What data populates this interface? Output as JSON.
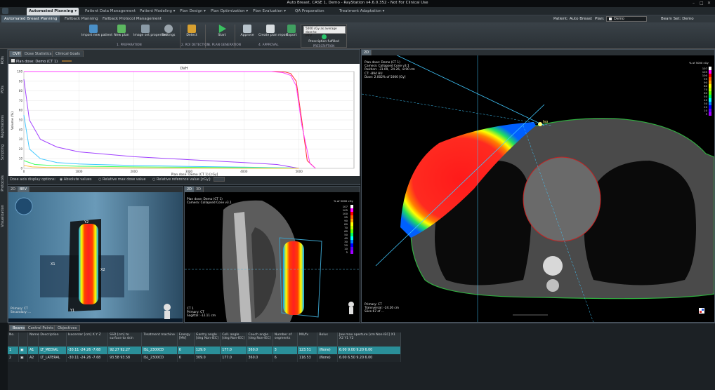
{
  "window": {
    "title": "Auto Breast, CASE 1, Demo - RayStation v4.6.0.352 - Not For Clinical Use",
    "controls": [
      "–",
      "□",
      "✕"
    ]
  },
  "nav": {
    "tabs": [
      "Automated Planning ▾",
      "Patient Data Management",
      "Patient Modeling ▾",
      "Plan Design ▾",
      "Plan Optimization ▾",
      "Plan Evaluation ▾",
      "QA Preparation",
      "Treatment Adaptation ▾"
    ]
  },
  "subnav": {
    "tabs": [
      "Automated Breast Planning",
      "Fallback Planning",
      "Fallback Protocol Management"
    ],
    "patient_label": "Patient: Auto Breast",
    "plan_label": "Plan:",
    "plan_value": "Demo",
    "beamset_label": "Beam Set: Demo"
  },
  "ribbon": {
    "buttons": [
      "Import new patient",
      "New plan",
      "Image set properties",
      "Settings",
      "Detect",
      "Start",
      "Approve",
      "Create plan report",
      "Export"
    ],
    "groups": [
      "1. PREPARATION",
      "2. ROI DETECTION",
      "3. PLAN GENERATION",
      "4. APPROVAL",
      "PRESCRIPTION"
    ],
    "prescription_box": "5000 cGy as average dose to",
    "prescription_roi": "PTV",
    "prescription_status": "Prescription fulfilled"
  },
  "left_tabs": [
    "ROIs",
    "POIs",
    "Registrations",
    "Scripting",
    "Protocols",
    "Visualization"
  ],
  "dvh_panel": {
    "tabs": [
      "DVH",
      "Dose Statistics",
      "Clinical Goals"
    ],
    "plan_dose_label": "Plan dose: Demo (CT 1)",
    "title": "DVH",
    "ylabel": "Volume (%)",
    "xlabel": "Plan dose: Demo (CT 1) [cGy]",
    "dose_options_label": "Dose axis display options:",
    "opt_absolute": "Absolute values",
    "opt_relative_max": "Relative max dose value",
    "opt_relative_ref": "Relative reference value [cGy]:"
  },
  "chart_data": {
    "type": "line",
    "title": "DVH",
    "xlabel": "Plan dose: Demo (CT 1) [cGy]",
    "ylabel": "Volume (%)",
    "xlim": [
      0,
      6000
    ],
    "ylim": [
      0,
      100
    ],
    "xticks": [
      0,
      1000,
      2000,
      3000,
      4000,
      5000
    ],
    "yticks": [
      0,
      10,
      20,
      30,
      40,
      50,
      60,
      70,
      80,
      90,
      100
    ],
    "grid": true,
    "series": [
      {
        "color": "#ff3030",
        "x": [
          0,
          4600,
          4750,
          4850,
          4950,
          5050,
          5150,
          5300
        ],
        "y": [
          100,
          100,
          99.5,
          98,
          90,
          50,
          8,
          0
        ]
      },
      {
        "color": "#ff40ff",
        "x": [
          0,
          4500,
          4700,
          4850,
          4950,
          5050,
          5200,
          5300
        ],
        "y": [
          100,
          100,
          99,
          96,
          85,
          45,
          5,
          0
        ]
      },
      {
        "color": "#a040ff",
        "x": [
          0,
          100,
          300,
          600,
          1000,
          2000,
          3000,
          4000,
          4600,
          4800,
          5000
        ],
        "y": [
          92,
          50,
          30,
          22,
          17,
          12,
          9,
          6,
          4,
          2,
          0
        ]
      },
      {
        "color": "#40c8ff",
        "x": [
          0,
          100,
          300,
          600,
          1000,
          2000,
          3000,
          4000,
          4800,
          5000
        ],
        "y": [
          55,
          20,
          10,
          6,
          4.5,
          3,
          2,
          1.2,
          0.5,
          0
        ]
      },
      {
        "color": "#40ff60",
        "x": [
          0,
          200,
          500,
          1000,
          2000,
          3000,
          4000,
          4800,
          5000
        ],
        "y": [
          8,
          4,
          3,
          2.2,
          1.5,
          1.1,
          0.7,
          0.3,
          0
        ]
      },
      {
        "color": "#ffc040",
        "x": [
          0,
          150,
          400,
          1000,
          2000,
          3000,
          4000,
          5000
        ],
        "y": [
          3,
          1.5,
          1,
          0.6,
          0.4,
          0.25,
          0.1,
          0
        ]
      }
    ]
  },
  "views": {
    "bev_tabs": [
      "2D",
      "BEV"
    ],
    "bev_labels": [
      "Y2",
      "X2",
      "X1",
      "Y1"
    ],
    "bev_overlay_bottom": [
      "Primary: CT",
      "Secondary: ..."
    ],
    "sag_tabs": [
      "2D",
      "3D"
    ],
    "sag_overlay": [
      "Plan dose: Demo (CT 1)",
      "Camera: Collapsed Cone v3.1"
    ],
    "sag_overlay_bottom": [
      "CT 1",
      "Primary: CT",
      "Sagittal: -12.11 cm"
    ],
    "sag_scale_title": "% of 5000 cGy",
    "ax_tabs": [
      "2D"
    ],
    "ax_overlay": [
      "Plan dose: Demo (CT 1)",
      "Camera: Collapsed Cone v3.1",
      "Position: -31.09, -24.26, -8.90 cm",
      "CT: -894 HU",
      "Dose: 2.002% of 5000 [Gy]"
    ],
    "ax_scale_title": "% of 5000 cGy",
    "ax_overlay_bottom": [
      "Primary: CT",
      "Transversal: -24.26 cm",
      "Slice 67 of ..."
    ],
    "ax_iso_label": "Iso",
    "scale_values": [
      "107",
      "105",
      "100",
      "95",
      "90",
      "80",
      "70",
      "60",
      "50",
      "40",
      "30",
      "20",
      "10",
      "5"
    ]
  },
  "beam_panel": {
    "tabs": [
      "Beams",
      "Control Points",
      "Objectives"
    ],
    "headers": [
      "No.",
      "",
      "Name",
      "Description",
      "Isocenter [cm] X  Y  Z",
      "SSD [cm] to surface  to skin",
      "Treatment machine",
      "Energy [MV]",
      "Gantry angle [deg Non-IEC]",
      "Coll. angle [deg Non-IEC]",
      "Couch angle [deg Non-IEC]",
      "Number of segments",
      "MU/fx",
      "Bolus",
      "Jaw max aperture [cm Non-IEC] X1  X2  Y1  Y2"
    ],
    "rows": [
      [
        "1",
        "A1",
        "LT_MEDIAL",
        "-30.11  -24.26  -7.68",
        "92.27  92.27",
        "ISL_2300CD",
        "6",
        "129.0",
        "177.0",
        "360.0",
        "3",
        "123.51",
        "(None)",
        "6.00  9.00  9.20  6.00"
      ],
      [
        "2",
        "A2",
        "LT_LATERAL",
        "-30.11  -24.26  -7.68",
        "93.58  93.58",
        "ISL_2300CD",
        "6",
        "309.0",
        "177.0",
        "360.0",
        "6",
        "116.53",
        "(None)",
        "6.00  6.50  9.20  6.00"
      ]
    ]
  },
  "colors": {
    "accent": "#2a8f99",
    "dose_colors": [
      "#ffffff",
      "#ff00ff",
      "#ff0000",
      "#ff6000",
      "#ffa000",
      "#ffff00",
      "#a0ff00",
      "#00ff60",
      "#00ffff",
      "#0080ff",
      "#0000ff",
      "#8000ff"
    ]
  }
}
